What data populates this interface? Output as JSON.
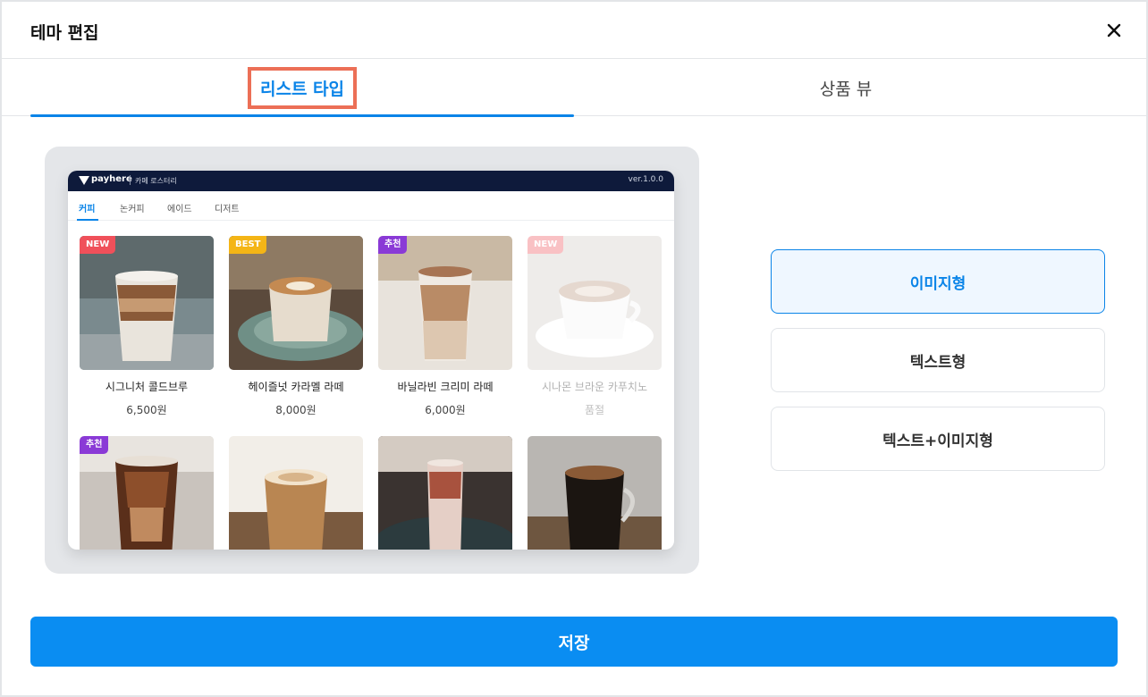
{
  "header": {
    "title": "테마 편집",
    "close_icon": "close-icon"
  },
  "tabs": [
    {
      "label": "리스트 타입",
      "active": true
    },
    {
      "label": "상품 뷰",
      "active": false
    }
  ],
  "preview": {
    "brand": "payhere",
    "store_name": "카페 로스터리",
    "version": "ver.1.0.0",
    "categories": [
      "커피",
      "논커피",
      "에이드",
      "디저트"
    ],
    "active_category": "커피",
    "products": [
      {
        "badge": "NEW",
        "badge_color": "#f0505a",
        "name": "시그니처 콜드브루",
        "price": "6,500원"
      },
      {
        "badge": "BEST",
        "badge_color": "#f4b516",
        "name": "헤이즐넛 카라멜 라떼",
        "price": "8,000원"
      },
      {
        "badge": "추천",
        "badge_color": "#8a3ad6",
        "name": "바닐라빈 크리미 라떼",
        "price": "6,000원"
      },
      {
        "badge": "NEW",
        "badge_color": "#f0505a",
        "name": "시나몬 브라운 카푸치노",
        "price": "품절",
        "sold_out": true
      },
      {
        "badge": "추천",
        "badge_color": "#8a3ad6"
      },
      {
        "badge": ""
      },
      {
        "badge": ""
      },
      {
        "badge": ""
      }
    ]
  },
  "view_options": [
    {
      "label": "이미지형",
      "selected": true
    },
    {
      "label": "텍스트형",
      "selected": false
    },
    {
      "label": "텍스트+이미지형",
      "selected": false
    }
  ],
  "save_label": "저장",
  "colors": {
    "accent": "#0a84e8",
    "highlight_border": "#ec6f56",
    "save_button": "#0a8df2"
  }
}
